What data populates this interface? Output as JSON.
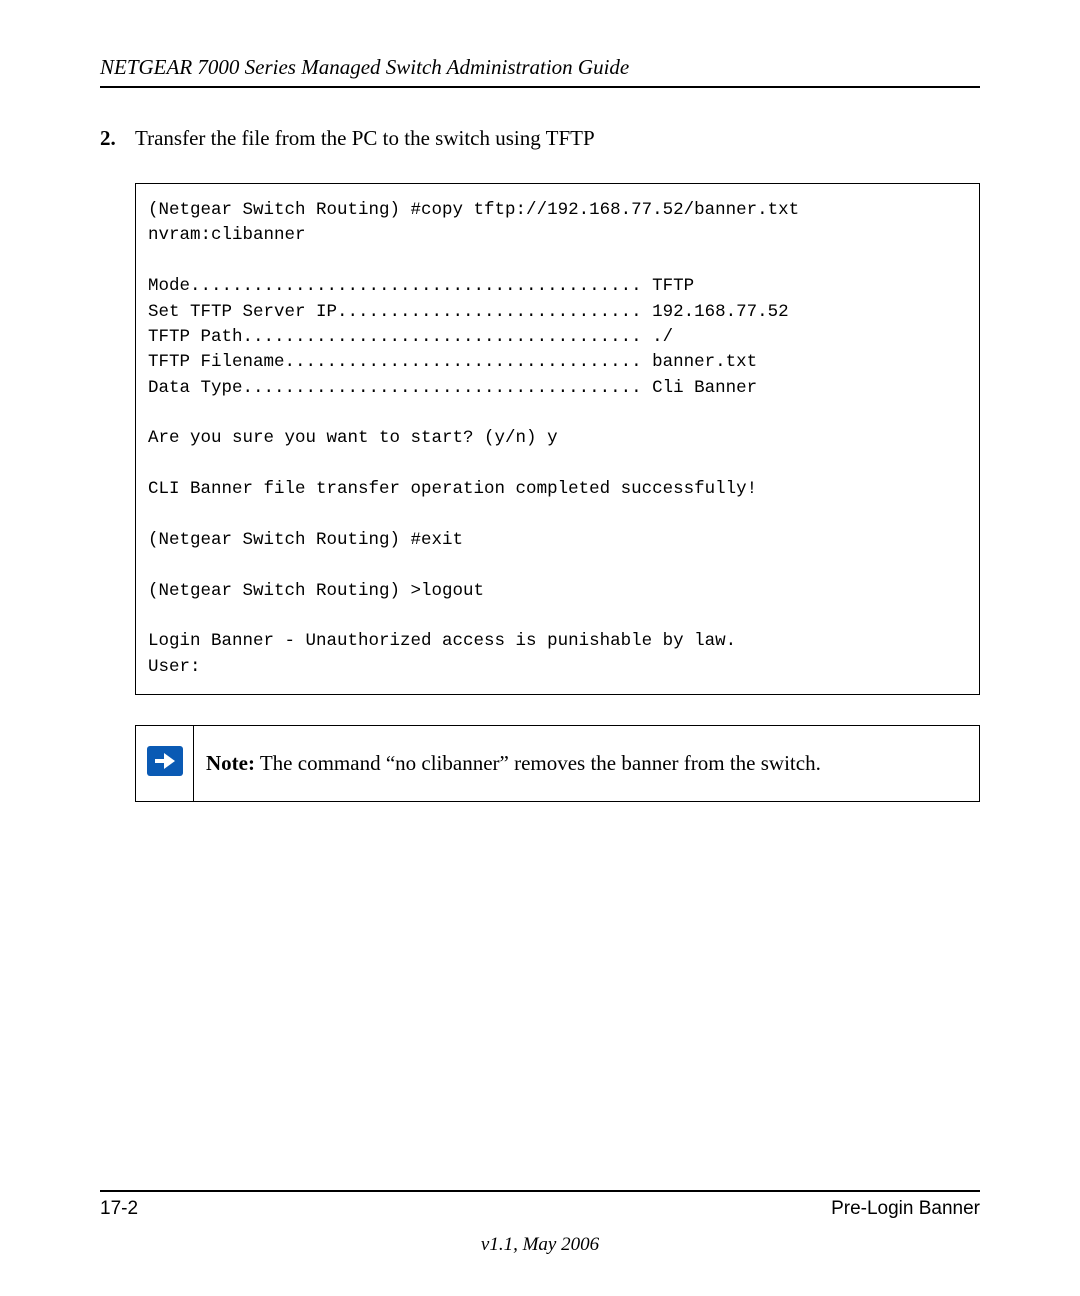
{
  "header": "NETGEAR 7000  Series Managed Switch Administration Guide",
  "step": {
    "number": "2.",
    "text": "Transfer the file from the PC to the switch using TFTP"
  },
  "code": "(Netgear Switch Routing) #copy tftp://192.168.77.52/banner.txt \nnvram:clibanner\n\nMode........................................... TFTP\nSet TFTP Server IP............................. 192.168.77.52\nTFTP Path...................................... ./\nTFTP Filename.................................. banner.txt\nData Type...................................... Cli Banner\n\nAre you sure you want to start? (y/n) y\n\nCLI Banner file transfer operation completed successfully!\n\n(Netgear Switch Routing) #exit\n\n(Netgear Switch Routing) >logout\n\nLogin Banner - Unauthorized access is punishable by law.\nUser:",
  "note": {
    "label": "Note:",
    "text": " The command “no clibanner” removes the banner from the switch."
  },
  "footer": {
    "page": "17-2",
    "section": "Pre-Login Banner",
    "version": "v1.1, May 2006"
  }
}
